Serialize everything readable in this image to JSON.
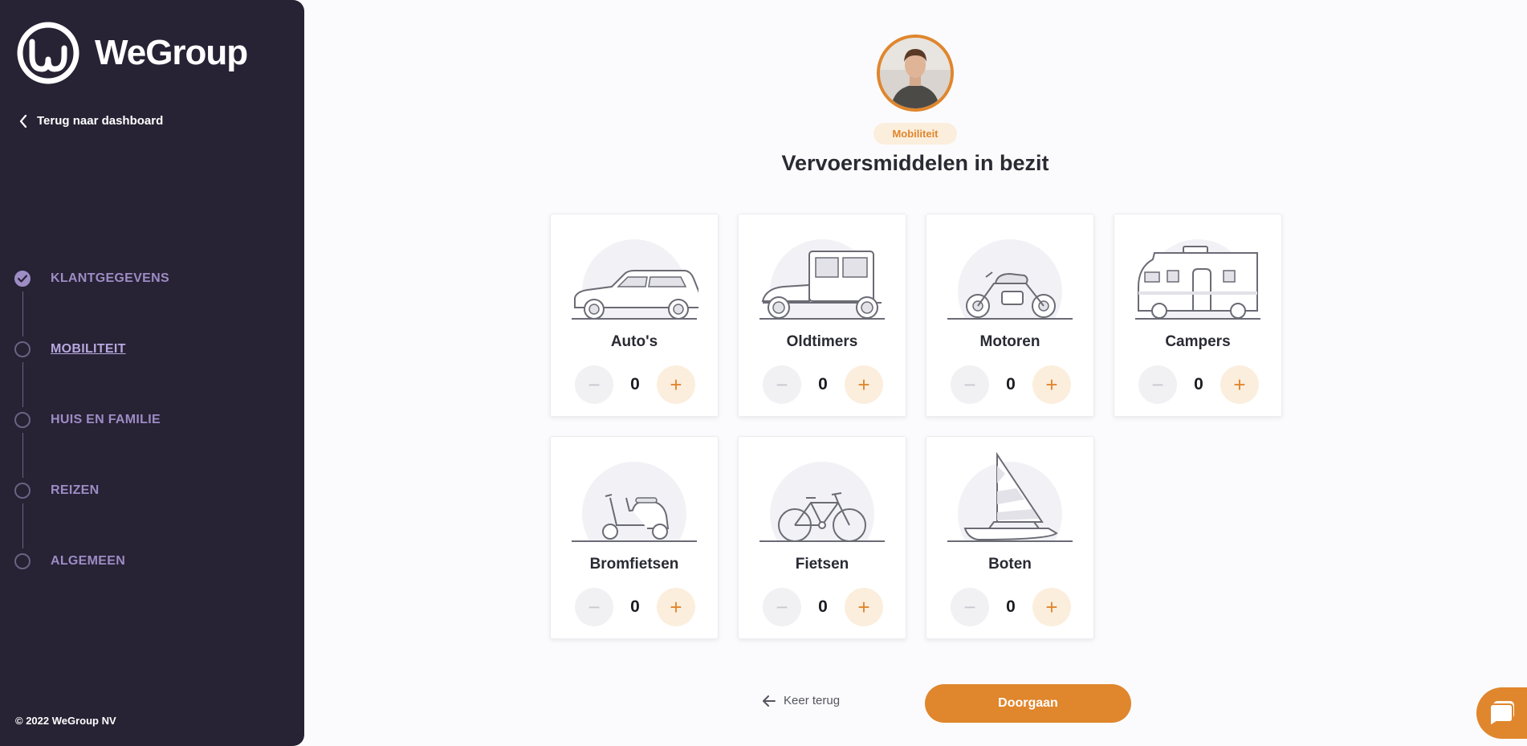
{
  "sidebar": {
    "brand": "WeGroup",
    "back_label": "Terug naar dashboard",
    "steps": [
      {
        "label": "KLANTGEGEVENS",
        "state": "done"
      },
      {
        "label": "MOBILITEIT",
        "state": "active"
      },
      {
        "label": "HUIS EN FAMILIE",
        "state": "todo"
      },
      {
        "label": "REIZEN",
        "state": "todo"
      },
      {
        "label": "ALGEMEEN",
        "state": "todo"
      }
    ],
    "copyright": "© 2022 WeGroup NV"
  },
  "main": {
    "category_pill": "Mobiliteit",
    "title": "Vervoersmiddelen in bezit",
    "vehicles": [
      {
        "name": "Auto's",
        "count": "0",
        "icon": "car-icon"
      },
      {
        "name": "Oldtimers",
        "count": "0",
        "icon": "oldtimer-icon"
      },
      {
        "name": "Motoren",
        "count": "0",
        "icon": "motorcycle-icon"
      },
      {
        "name": "Campers",
        "count": "0",
        "icon": "camper-icon"
      },
      {
        "name": "Bromfietsen",
        "count": "0",
        "icon": "scooter-icon"
      },
      {
        "name": "Fietsen",
        "count": "0",
        "icon": "bicycle-icon"
      },
      {
        "name": "Boten",
        "count": "0",
        "icon": "sailboat-icon"
      }
    ],
    "minus_symbol": "−",
    "plus_symbol": "+"
  },
  "footer": {
    "back_label": "Keer terug",
    "continue_label": "Doorgaan"
  },
  "colors": {
    "sidebar_bg": "#272234",
    "accent": "#e0862d",
    "step_purple": "#9d8cc5"
  }
}
